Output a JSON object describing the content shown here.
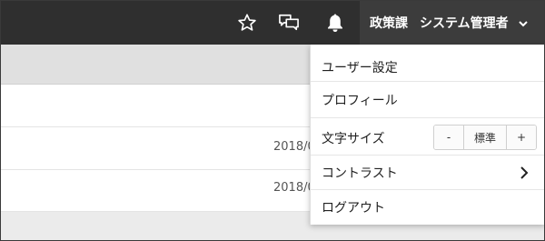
{
  "topbar": {
    "icons": [
      "star-icon",
      "chat-icon",
      "bell-icon"
    ],
    "department": "政策課",
    "user_name": "システム管理者"
  },
  "content": {
    "rows": [
      {
        "date": "2018/0"
      },
      {
        "date": "2018/0"
      }
    ]
  },
  "dropdown": {
    "items": {
      "user_settings": "ユーザー設定",
      "profile": "プロフィール",
      "text_size_label": "文字サイズ",
      "contrast": "コントラスト",
      "logout": "ログアウト"
    },
    "text_size": {
      "decrease": "-",
      "current": "標準",
      "increase": "+"
    }
  },
  "colors": {
    "topbar": "#2f2f2f",
    "user_menu_bg": "#3c3c3c",
    "dropdown_bg": "#ffffff"
  }
}
